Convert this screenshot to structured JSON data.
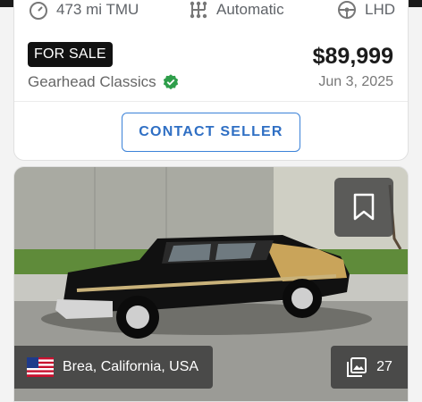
{
  "listing": {
    "specs": {
      "mileage": "473 mi TMU",
      "transmission": "Automatic",
      "steering": "LHD"
    },
    "status_badge": "FOR SALE",
    "price": "$89,999",
    "seller_name": "Gearhead Classics",
    "date": "Jun 3, 2025",
    "contact_label": "CONTACT SELLER"
  },
  "next_listing": {
    "location": "Brea, California, USA",
    "photo_count": "27"
  },
  "colors": {
    "accent": "#3b82d8",
    "verified": "#2e9e4a",
    "badge_bg": "#111111"
  }
}
